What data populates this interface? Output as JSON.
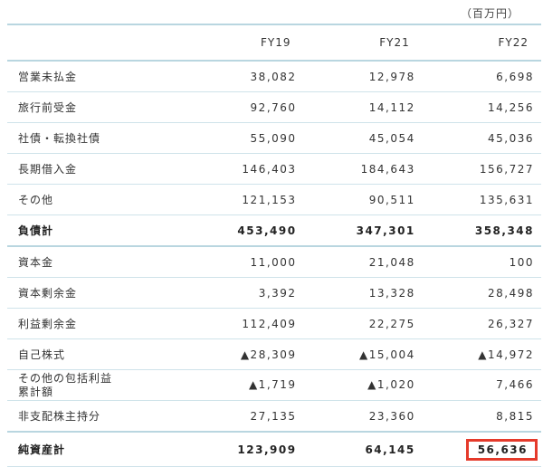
{
  "unit": "（百万円）",
  "columns": [
    "FY19",
    "FY21",
    "FY22"
  ],
  "rows": [
    {
      "label": "営業未払金",
      "values": [
        "38,082",
        "12,978",
        "6,698"
      ]
    },
    {
      "label": "旅行前受金",
      "values": [
        "92,760",
        "14,112",
        "14,256"
      ]
    },
    {
      "label": "社債・転換社債",
      "values": [
        "55,090",
        "45,054",
        "45,036"
      ]
    },
    {
      "label": "長期借入金",
      "values": [
        "146,403",
        "184,643",
        "156,727"
      ]
    },
    {
      "label": "その他",
      "values": [
        "121,153",
        "90,511",
        "135,631"
      ]
    },
    {
      "label": "負債計",
      "values": [
        "453,490",
        "347,301",
        "358,348"
      ]
    },
    {
      "label": "資本金",
      "values": [
        "11,000",
        "21,048",
        "100"
      ]
    },
    {
      "label": "資本剰余金",
      "values": [
        "3,392",
        "13,328",
        "28,498"
      ]
    },
    {
      "label": "利益剰余金",
      "values": [
        "112,409",
        "22,275",
        "26,327"
      ]
    },
    {
      "label": "自己株式",
      "values": [
        "▲28,309",
        "▲15,004",
        "▲14,972"
      ]
    },
    {
      "label_line1": "その他の包括利益",
      "label_line2": "累計額",
      "values": [
        "▲1,719",
        "▲1,020",
        "7,466"
      ]
    },
    {
      "label": "非支配株主持分",
      "values": [
        "27,135",
        "23,360",
        "8,815"
      ]
    },
    {
      "label": "純資産計",
      "values": [
        "123,909",
        "64,145",
        "56,636"
      ]
    }
  ],
  "highlight_color": "#e53a2b"
}
